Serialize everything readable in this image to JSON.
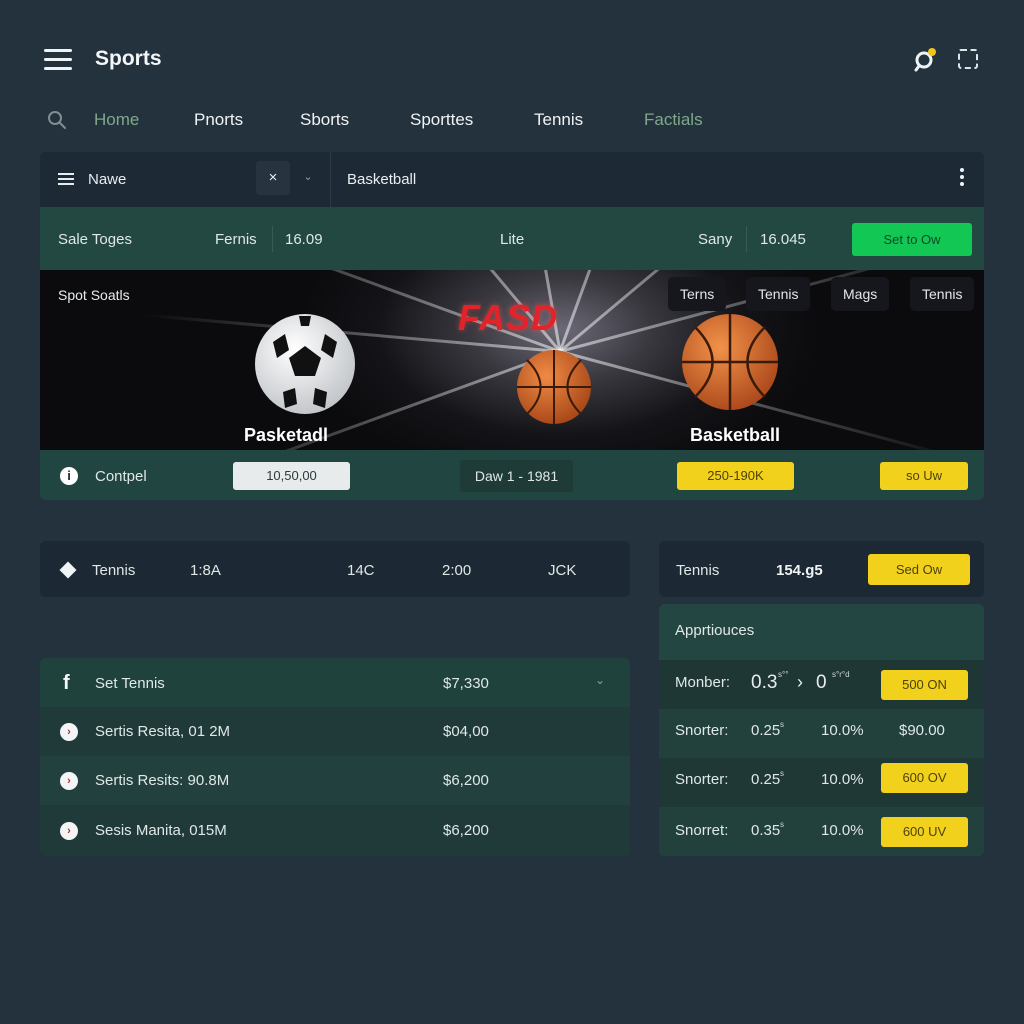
{
  "header": {
    "title": "Sports",
    "menu_icon": "hamburger-icon",
    "notification_icon": "bell-icon",
    "expand_icon": "expand-icon"
  },
  "nav": {
    "tabs": [
      {
        "label": "Home"
      },
      {
        "label": "Pnorts"
      },
      {
        "label": "Sborts"
      },
      {
        "label": "Sporttes"
      },
      {
        "label": "Tennis"
      },
      {
        "label": "Factials"
      }
    ]
  },
  "filter": {
    "name_label": "Nawe",
    "close_label": "×",
    "chevron": "⌄",
    "sport": "Basketball"
  },
  "sale_row": {
    "label": "Sale Toges",
    "sport": "Fernis",
    "value1": "16.09",
    "mid": "Lite",
    "user": "Sany",
    "value2": "16.045",
    "button": "Set to Ow"
  },
  "banner": {
    "title": "Spot Soatls",
    "logo_text": "FASD",
    "pills": [
      "Terns",
      "Tennis",
      "Mags",
      "Tennis"
    ],
    "left_ball_label": "Pasketadl",
    "right_ball_label": "Basketball"
  },
  "control_row": {
    "info_icon": "i",
    "label": "Contpel",
    "value_box": "10,50,00",
    "date": "Daw 1 - 1981",
    "yellow_value": "250-190K",
    "button": "so Uw"
  },
  "tennis_row": {
    "label": "Tennis",
    "c1": "1:8A",
    "c2": "14C",
    "c3": "2:00",
    "c4": "JCK"
  },
  "list": {
    "rows": [
      {
        "icon": "f",
        "label": "Set Tennis",
        "amount": "$7,330"
      },
      {
        "icon": "›",
        "label": "Sertis Resita, 01 2M",
        "amount": "$04,00"
      },
      {
        "icon": "›",
        "label": "Sertis Resits: 90.8M",
        "amount": "$6,200"
      },
      {
        "icon": "›",
        "label": "Sesis Manita, 015M",
        "amount": "$6,200"
      }
    ]
  },
  "right_top": {
    "label": "Tennis",
    "value": "154.g5",
    "button": "Sed Ow"
  },
  "applications": {
    "title": "Apprtiouces",
    "rows": [
      {
        "label": "Monber:",
        "v1": "0.3",
        "v1_sup": "s°°",
        "arrow": "›",
        "v2": "0",
        "v2_sup": "s°r°d",
        "action": "500 ON",
        "action_is_button": true
      },
      {
        "label": "Snorter:",
        "v1": "0.25",
        "v1_sup": "s",
        "v2": "10.0%",
        "action": "$90.00",
        "action_is_button": false
      },
      {
        "label": "Snorter:",
        "v1": "0.25",
        "v1_sup": "s",
        "v2": "10.0%",
        "action": "600 OV",
        "action_is_button": true
      },
      {
        "label": "Snorret:",
        "v1": "0.35",
        "v1_sup": "s",
        "v2": "10.0%",
        "action": "600 UV",
        "action_is_button": true
      }
    ]
  },
  "colors": {
    "background": "#24323e",
    "accent_green": "#12c753",
    "accent_yellow": "#f2d11d",
    "teal_row": "#234842"
  }
}
